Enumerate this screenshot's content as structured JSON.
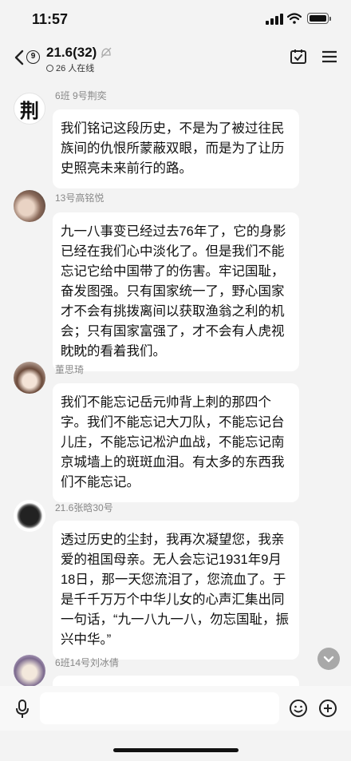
{
  "status_bar": {
    "time": "11:57"
  },
  "header": {
    "title": "21.6(32)",
    "unread_count": "9",
    "online": "26 人在线"
  },
  "messages": [
    {
      "sender": "6班 9号荆奕",
      "avatar_text": "荆",
      "text": "我们铭记这段历史，不是为了被过往民族间的仇恨所蒙蔽双眼，而是为了让历史照亮未来前行的路。"
    },
    {
      "sender": "13号高铭悦",
      "text": "九一八事变已经过去76年了，它的身影已经在我们心中淡化了。但是我们不能忘记它给中国带了的伤害。牢记国耻，奋发图强。只有国家统一了，野心国家才不会有挑拨离间以获取渔翁之利的机会；只有国家富强了，才不会有人虎视眈眈的看着我们。"
    },
    {
      "sender": "董思琦",
      "text": "我们不能忘记岳元帅背上刺的那四个字。我们不能忘记大刀队，不能忘记台儿庄，不能忘记凇沪血战，不能忘记南京城墙上的斑斑血泪。有太多的东西我们不能忘记。"
    },
    {
      "sender": "21.6张晗30号",
      "text": "透过历史的尘封，我再次凝望您，我亲爱的祖国母亲。无人会忘记1931年9月18日，那一天您流泪了，您流血了。于是千千万万个中华儿女的心声汇集出同一句话，“九一八九一八，勿忘国耻，振兴中华。”"
    },
    {
      "sender": "6班14号刘冰倩",
      "text": ""
    }
  ],
  "input": {
    "placeholder": ""
  }
}
